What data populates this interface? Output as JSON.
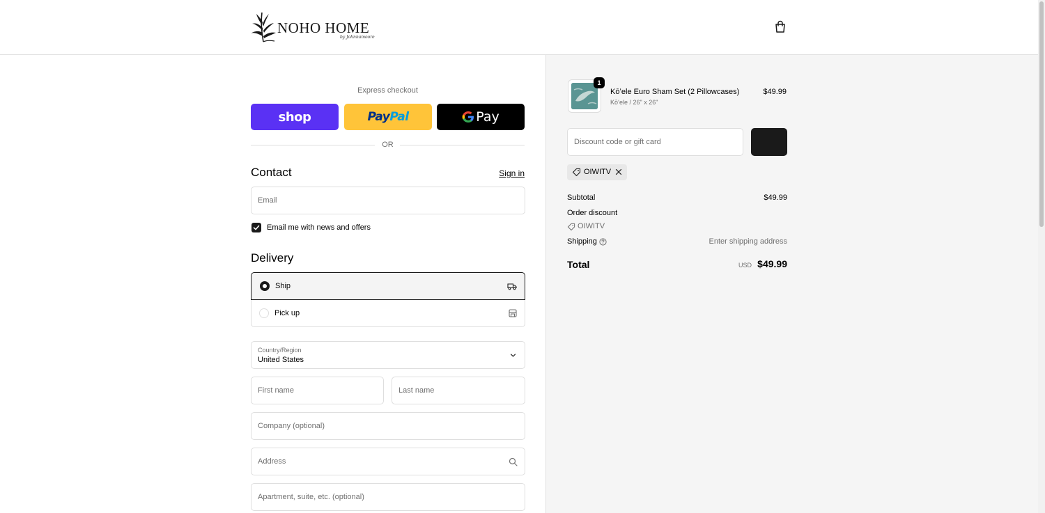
{
  "header": {
    "logo_text": "NOHO HOME",
    "logo_sub": "by Johnnamoore",
    "cart_icon": "shopping-bag-icon"
  },
  "express": {
    "label": "Express checkout",
    "shop": "shop",
    "paypal_a": "Pay",
    "paypal_b": "Pal",
    "gpay": "Pay",
    "or": "OR"
  },
  "contact": {
    "heading": "Contact",
    "sign_in": "Sign in",
    "email_placeholder": "Email",
    "newsletter_label": "Email me with news and offers",
    "newsletter_checked": true
  },
  "delivery": {
    "heading": "Delivery",
    "options": [
      {
        "label": "Ship",
        "selected": true,
        "icon": "truck-icon"
      },
      {
        "label": "Pick up",
        "selected": false,
        "icon": "store-icon"
      }
    ],
    "country_label": "Country/Region",
    "country_value": "United States",
    "first_name": "First name",
    "last_name": "Last name",
    "company": "Company (optional)",
    "address": "Address",
    "apartment": "Apartment, suite, etc. (optional)"
  },
  "summary": {
    "item": {
      "title": "Kōʻele Euro Sham Set (2 Pillowcases)",
      "variant": "Kōʻele / 26\" x 26\"",
      "price": "$49.99",
      "quantity": "1"
    },
    "discount_placeholder": "Discount code or gift card",
    "applied_code": "OIWITV",
    "subtotal_label": "Subtotal",
    "subtotal_value": "$49.99",
    "order_discount_label": "Order discount",
    "order_discount_code": "OIWITV",
    "shipping_label": "Shipping",
    "shipping_value": "Enter shipping address",
    "total_label": "Total",
    "currency": "USD",
    "total_value": "$49.99"
  },
  "colors": {
    "shop_purple": "#5a31f4",
    "paypal_yellow": "#ffc439",
    "gpay_black": "#000000",
    "summary_bg": "#f5f5f5"
  }
}
